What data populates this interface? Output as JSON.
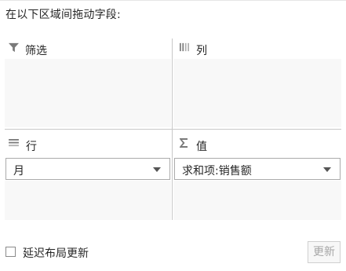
{
  "instruction": "在以下区域间拖动字段:",
  "areas": {
    "filter": {
      "label": "筛选",
      "icon": "filter-icon"
    },
    "columns": {
      "label": "列",
      "icon": "columns-icon"
    },
    "rows": {
      "label": "行",
      "icon": "rows-icon",
      "field": "月"
    },
    "values": {
      "label": "值",
      "icon": "sigma-icon",
      "field": "求和项:销售额"
    }
  },
  "footer": {
    "defer_label": "延迟布局更新",
    "defer_checked": false,
    "update_label": "更新",
    "update_enabled": false
  },
  "colors": {
    "area_background": "#f8f8f8",
    "divider": "#c8c8c8",
    "text": "#262626",
    "disabled_text": "#a6a6a6",
    "icon": "#7a7a7a"
  }
}
